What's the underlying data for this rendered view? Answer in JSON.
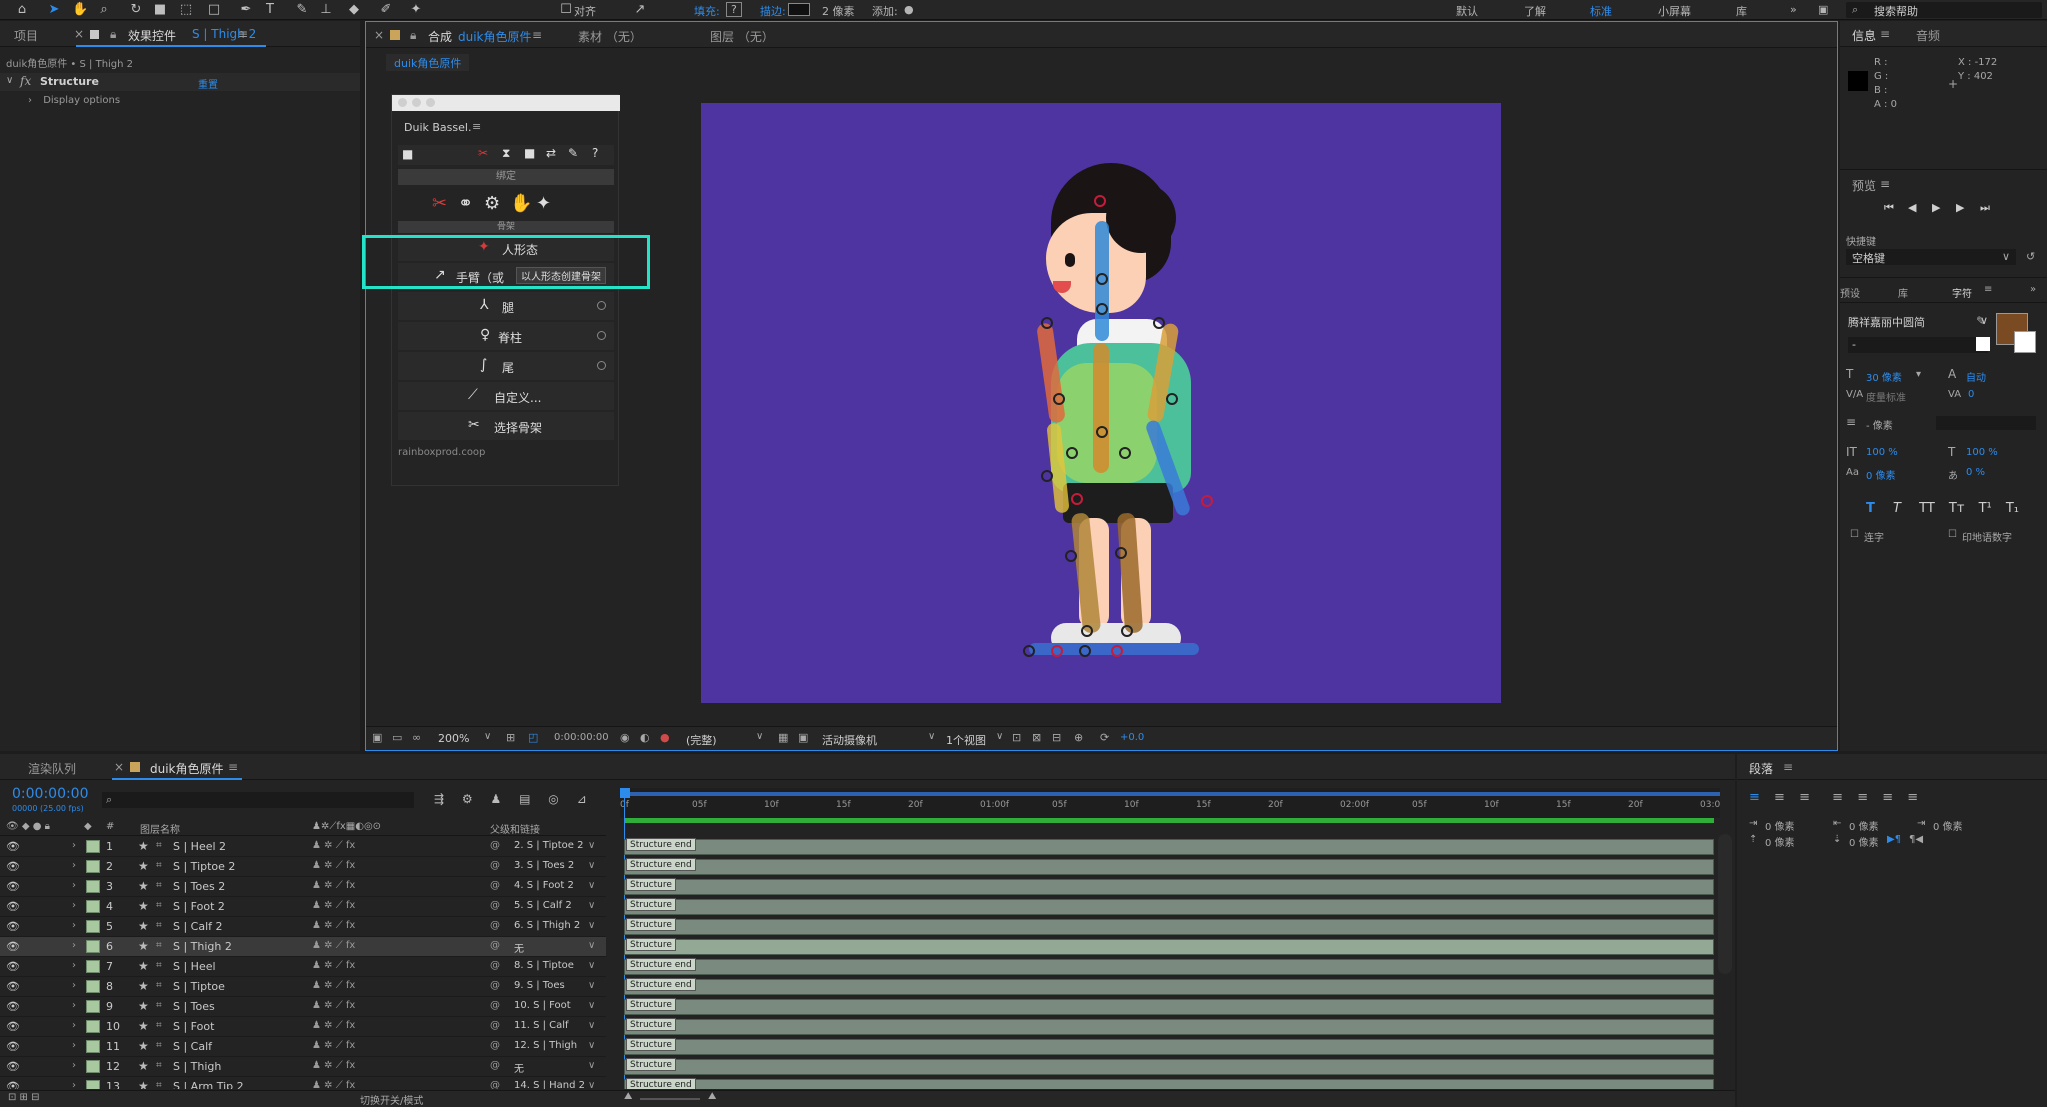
{
  "toolbar": {
    "align_label": "对齐",
    "fill_label": "填充:",
    "fill_value": "?",
    "stroke_label": "描边:",
    "stroke_px": "2 像素",
    "add_label": "添加:",
    "workspaces": [
      "默认",
      "了解",
      "标准",
      "小屏幕",
      "库"
    ],
    "search_help": "搜索帮助"
  },
  "left_panel": {
    "tab_project": "项目",
    "tab_effects": "效果控件",
    "tab_effects_layer": "S | Thigh 2",
    "breadcrumb": "duik角色原件 • S | Thigh 2",
    "fx_label": "fx",
    "effect_name": "Structure",
    "reset_label": "重置",
    "display_options": "Display options"
  },
  "comp_panel": {
    "tab_comp_prefix": "合成",
    "tab_comp_name": "duik角色原件",
    "tab_footage": "素材 （无）",
    "tab_layer": "图层 （无）",
    "sub_tab": "duik角色原件",
    "zoom": "200%",
    "timecode": "0:00:00:00",
    "quality": "(完整)",
    "camera": "活动摄像机",
    "views": "1个视图",
    "exposure": "+0.0",
    "bg_color": "#4e34a0"
  },
  "duik": {
    "title": "Duik Bassel.",
    "section_bind": "绑定",
    "section_bones": "骨架",
    "highlight_btn": "人形态",
    "arm_label": "手臂（或",
    "tooltip": "以人形态创建骨架",
    "items": [
      "腿",
      "脊柱",
      "尾",
      "自定义...",
      "选择骨架"
    ],
    "footer": "rainboxprod.coop",
    "highlight_color": "#23e3c9"
  },
  "right_panel": {
    "tab_info": "信息",
    "tab_audio": "音频",
    "info_r": "R :",
    "info_g": "G :",
    "info_b": "B :",
    "info_a": "A : 0",
    "info_x": "X : -172",
    "info_y": "Y : 402",
    "preview_title": "预览",
    "shortcut_label": "快捷键",
    "shortcut_value": "空格键",
    "tab_presets": "预设",
    "tab_library": "库",
    "tab_character": "字符",
    "font_name": "腾祥嘉丽中圆简",
    "font_style": "-",
    "font_size": "30 像素",
    "leading": "自动",
    "kerning": "度量标准",
    "tracking": "0",
    "stroke_width": "- 像素",
    "vscale": "100 %",
    "hscale": "100 %",
    "baseline": "0 像素",
    "tsume": "0 %",
    "ligatures": "连字",
    "hindi_digits": "印地语数字",
    "fill_swatch": "#7a4a22"
  },
  "timeline": {
    "tab_render": "渲染队列",
    "tab_comp": "duik角色原件",
    "timecode": "0:00:00:00",
    "fps_info": "00000 (25.00 fps)",
    "col_name": "图层名称",
    "col_parent": "父级和链接",
    "ruler": [
      "0f",
      "05f",
      "10f",
      "15f",
      "20f",
      "01:00f",
      "05f",
      "10f",
      "15f",
      "20f",
      "02:00f",
      "05f",
      "10f",
      "15f",
      "20f",
      "03:0"
    ],
    "bottom_label": "切换开关/模式",
    "layers": [
      {
        "num": "1",
        "name": "S | Heel 2",
        "parent": "2. S | Tiptoe 2",
        "bar": "Structure end"
      },
      {
        "num": "2",
        "name": "S | Tiptoe 2",
        "parent": "3. S | Toes 2",
        "bar": "Structure end"
      },
      {
        "num": "3",
        "name": "S | Toes 2",
        "parent": "4. S | Foot 2",
        "bar": "Structure"
      },
      {
        "num": "4",
        "name": "S | Foot 2",
        "parent": "5. S | Calf 2",
        "bar": "Structure"
      },
      {
        "num": "5",
        "name": "S | Calf 2",
        "parent": "6. S | Thigh 2",
        "bar": "Structure"
      },
      {
        "num": "6",
        "name": "S | Thigh 2",
        "parent": "无",
        "bar": "Structure"
      },
      {
        "num": "7",
        "name": "S | Heel",
        "parent": "8. S | Tiptoe",
        "bar": "Structure end"
      },
      {
        "num": "8",
        "name": "S | Tiptoe",
        "parent": "9. S | Toes",
        "bar": "Structure end"
      },
      {
        "num": "9",
        "name": "S | Toes",
        "parent": "10. S | Foot",
        "bar": "Structure"
      },
      {
        "num": "10",
        "name": "S | Foot",
        "parent": "11. S | Calf",
        "bar": "Structure"
      },
      {
        "num": "11",
        "name": "S | Calf",
        "parent": "12. S | Thigh",
        "bar": "Structure"
      },
      {
        "num": "12",
        "name": "S | Thigh",
        "parent": "无",
        "bar": "Structure"
      },
      {
        "num": "13",
        "name": "S | Arm Tip 2",
        "parent": "14. S | Hand 2",
        "bar": "Structure end"
      }
    ]
  },
  "paragraph": {
    "title": "段落",
    "indent_left": "0 像素",
    "indent_right": "0 像素",
    "indent_first": "0 像素",
    "space_before": "0 像素",
    "space_after": "0 像素"
  }
}
